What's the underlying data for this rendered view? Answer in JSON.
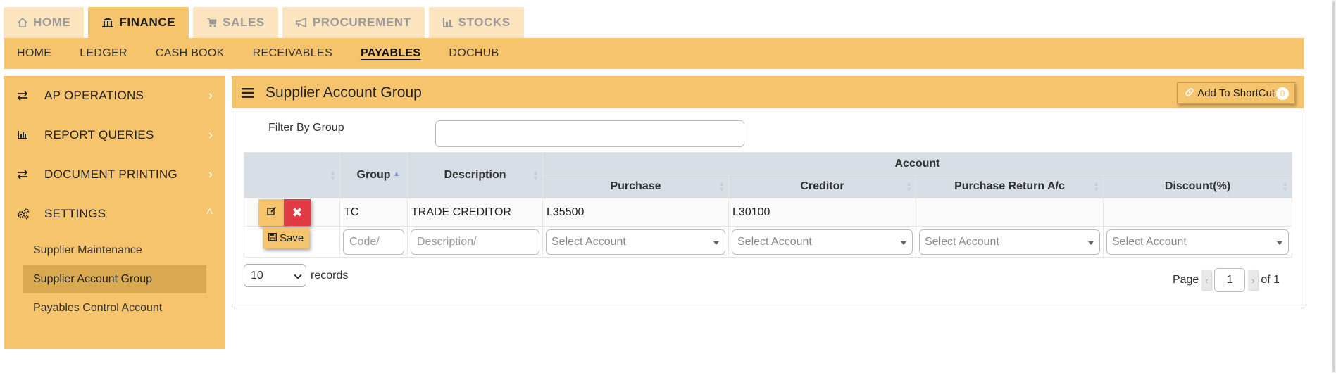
{
  "top_tabs": [
    {
      "label": "HOME",
      "icon": "home-icon",
      "active": false
    },
    {
      "label": "FINANCE",
      "icon": "bank-icon",
      "active": true
    },
    {
      "label": "SALES",
      "icon": "cart-icon",
      "active": false
    },
    {
      "label": "PROCUREMENT",
      "icon": "bullhorn-icon",
      "active": false
    },
    {
      "label": "STOCKS",
      "icon": "bar-chart-icon",
      "active": false
    }
  ],
  "sub_nav": [
    "HOME",
    "LEDGER",
    "CASH BOOK",
    "RECEIVABLES",
    "PAYABLES",
    "DOCHUB"
  ],
  "sub_nav_active": "PAYABLES",
  "sidebar": {
    "items": [
      {
        "label": "AP OPERATIONS",
        "icon": "exchange-icon",
        "chevron": "›"
      },
      {
        "label": "REPORT QUERIES",
        "icon": "bar-chart-icon",
        "chevron": "›"
      },
      {
        "label": "DOCUMENT PRINTING",
        "icon": "exchange-icon",
        "chevron": "›"
      },
      {
        "label": "SETTINGS",
        "icon": "cogs-icon",
        "chevron": "^"
      }
    ],
    "sub_items": [
      "Supplier Maintenance",
      "Supplier Account Group",
      "Payables Control Account"
    ],
    "active_sub_item": "Supplier Account Group"
  },
  "panel": {
    "title": "Supplier Account Group",
    "shortcut_label": "Add To ShortCut",
    "shortcut_count": "0",
    "filter_label": "Filter By Group",
    "filter_value": ""
  },
  "table": {
    "headers": {
      "group": "Group",
      "description": "Description",
      "account": "Account",
      "purchase": "Purchase",
      "creditor": "Creditor",
      "purchase_return": "Purchase Return A/c",
      "discount": "Discount(%)"
    },
    "rows": [
      {
        "group": "TC",
        "description": "TRADE CREDITOR",
        "purchase": "L35500",
        "creditor": "L30100",
        "purchase_return": "",
        "discount": ""
      }
    ],
    "new_row": {
      "save_label": "Save",
      "code_placeholder": "Code/",
      "description_placeholder": "Description/",
      "select_placeholder": "Select Account"
    },
    "delete_symbol": "✖"
  },
  "pager": {
    "records_value": "10",
    "records_label": "records",
    "page_label": "Page",
    "page_value": "1",
    "of_label": "of 1",
    "prev": "‹",
    "next": "›"
  },
  "colors": {
    "accent": "#f7c46e",
    "tab_inactive": "#fce4bf",
    "active_sub": "#d9a94f",
    "delete": "#e03a45",
    "table_header": "#d8dee6"
  }
}
